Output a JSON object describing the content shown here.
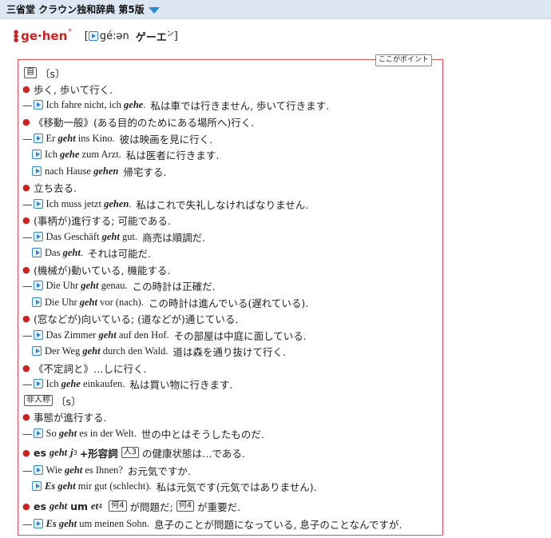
{
  "app": {
    "title": "三省堂 クラウン独和辞典 第5版"
  },
  "entry": {
    "headword": "ge·hen",
    "headword_mark": "*",
    "pronunciation": "gé:ən",
    "katakana": "ゲーエン",
    "katakana_small": "ン",
    "katakana_main": "ゲーエ",
    "point_label": "ここがポイント",
    "tag_verb": "自",
    "tag_s1": "〔s〕",
    "tag_impersonal": "非人称",
    "tag_s2": "〔s〕",
    "senses": [
      {
        "text": "歩く, 歩いて行く."
      },
      {
        "text": "《移動一般》(ある目的のためにある場所へ)行く."
      },
      {
        "text": "立ち去る."
      },
      {
        "text": "(事柄が)進行する; 可能である."
      },
      {
        "text": "(機械が)動いている, 機能する."
      },
      {
        "text": "(窓などが)向いている; (道などが)通じている."
      },
      {
        "text": "《不定詞と》…しに行く."
      },
      {
        "text": "事態が進行する."
      }
    ],
    "examples": [
      {
        "pre": "Ich fahre nicht, ich ",
        "kw": "gehe",
        "post": ".",
        "jp": "私は車では行きません, 歩いて行きます."
      },
      {
        "pre": "Er ",
        "kw": "geht",
        "post": " ins Kino.",
        "jp": "彼は映画を見に行く."
      },
      {
        "pre": "Ich ",
        "kw": "gehe",
        "post": " zum Arzt.",
        "jp": "私は医者に行きます."
      },
      {
        "pre": "nach Hause ",
        "kw": "gehen",
        "post": "",
        "jp": "帰宅する."
      },
      {
        "pre": "Ich muss jetzt ",
        "kw": "gehen",
        "post": ".",
        "jp": "私はこれで失礼しなければなりません."
      },
      {
        "pre": "Das Geschäft ",
        "kw": "geht",
        "post": " gut.",
        "jp": "商売は順調だ."
      },
      {
        "pre": "Das ",
        "kw": "geht",
        "post": ".",
        "jp": "それは可能だ."
      },
      {
        "pre": "Die Uhr ",
        "kw": "geht",
        "post": " genau.",
        "jp": "この時計は正確だ."
      },
      {
        "pre": "Die Uhr ",
        "kw": "geht",
        "post": " vor (nach).",
        "jp": "この時計は進んでいる(遅れている)."
      },
      {
        "pre": "Das Zimmer ",
        "kw": "geht",
        "post": " auf den Hof.",
        "jp": "その部屋は中庭に面している."
      },
      {
        "pre": "Der Weg ",
        "kw": "geht",
        "post": " durch den Wald.",
        "jp": "道は森を通り抜けて行く."
      },
      {
        "pre": "Ich ",
        "kw": "gehe",
        "post": " einkaufen.",
        "jp": "私は買い物に行きます."
      },
      {
        "pre": "So ",
        "kw": "geht",
        "post": " es in der Welt.",
        "jp": "世の中とはそうしたものだ."
      },
      {
        "pre": "Wie ",
        "kw": "geht",
        "post": " es Ihnen?",
        "jp": "お元気ですか."
      },
      {
        "pre": "",
        "kw": "Es geht",
        "post": " mir gut (schlecht).",
        "jp": "私は元気です(元気ではありません)."
      },
      {
        "pre": "",
        "kw": "Es geht",
        "post": " um meinen Sohn.",
        "jp": "息子のことが問題になっている, 息子のことなんですが."
      }
    ],
    "idiom1": {
      "es": "es",
      "geht": "geht",
      "j": "j",
      "sup": "3",
      "plus": "+形容詞",
      "tag": "人3",
      "rest": "の健康状態は…である."
    },
    "idiom2": {
      "es": "es",
      "geht": "geht",
      "um": "um",
      "et": "et",
      "sup": "4",
      "tag1": "何4",
      "mid": "が問題だ;",
      "tag2": "何4",
      "rest": "が重要だ."
    }
  }
}
